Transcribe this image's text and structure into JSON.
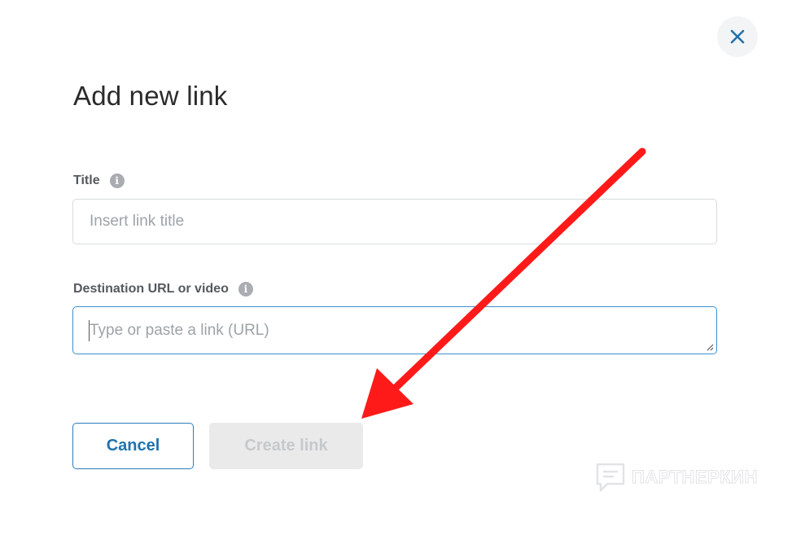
{
  "dialog": {
    "title": "Add new link",
    "close_icon": "close-icon",
    "accent_color": "#2172ad"
  },
  "fields": {
    "title": {
      "label": "Title",
      "placeholder": "Insert link title",
      "value": "",
      "info_icon": "info-icon"
    },
    "url": {
      "label": "Destination URL or video",
      "placeholder": "Type or paste a link (URL)",
      "value": "",
      "info_icon": "info-icon"
    }
  },
  "actions": {
    "cancel_label": "Cancel",
    "create_label": "Create link",
    "create_enabled": false
  },
  "annotation": {
    "icon": "arrow-icon",
    "color": "#ff1a1a"
  },
  "watermark": {
    "text": "ПАРТНЕРКИН",
    "icon": "chat-bubble-icon"
  }
}
